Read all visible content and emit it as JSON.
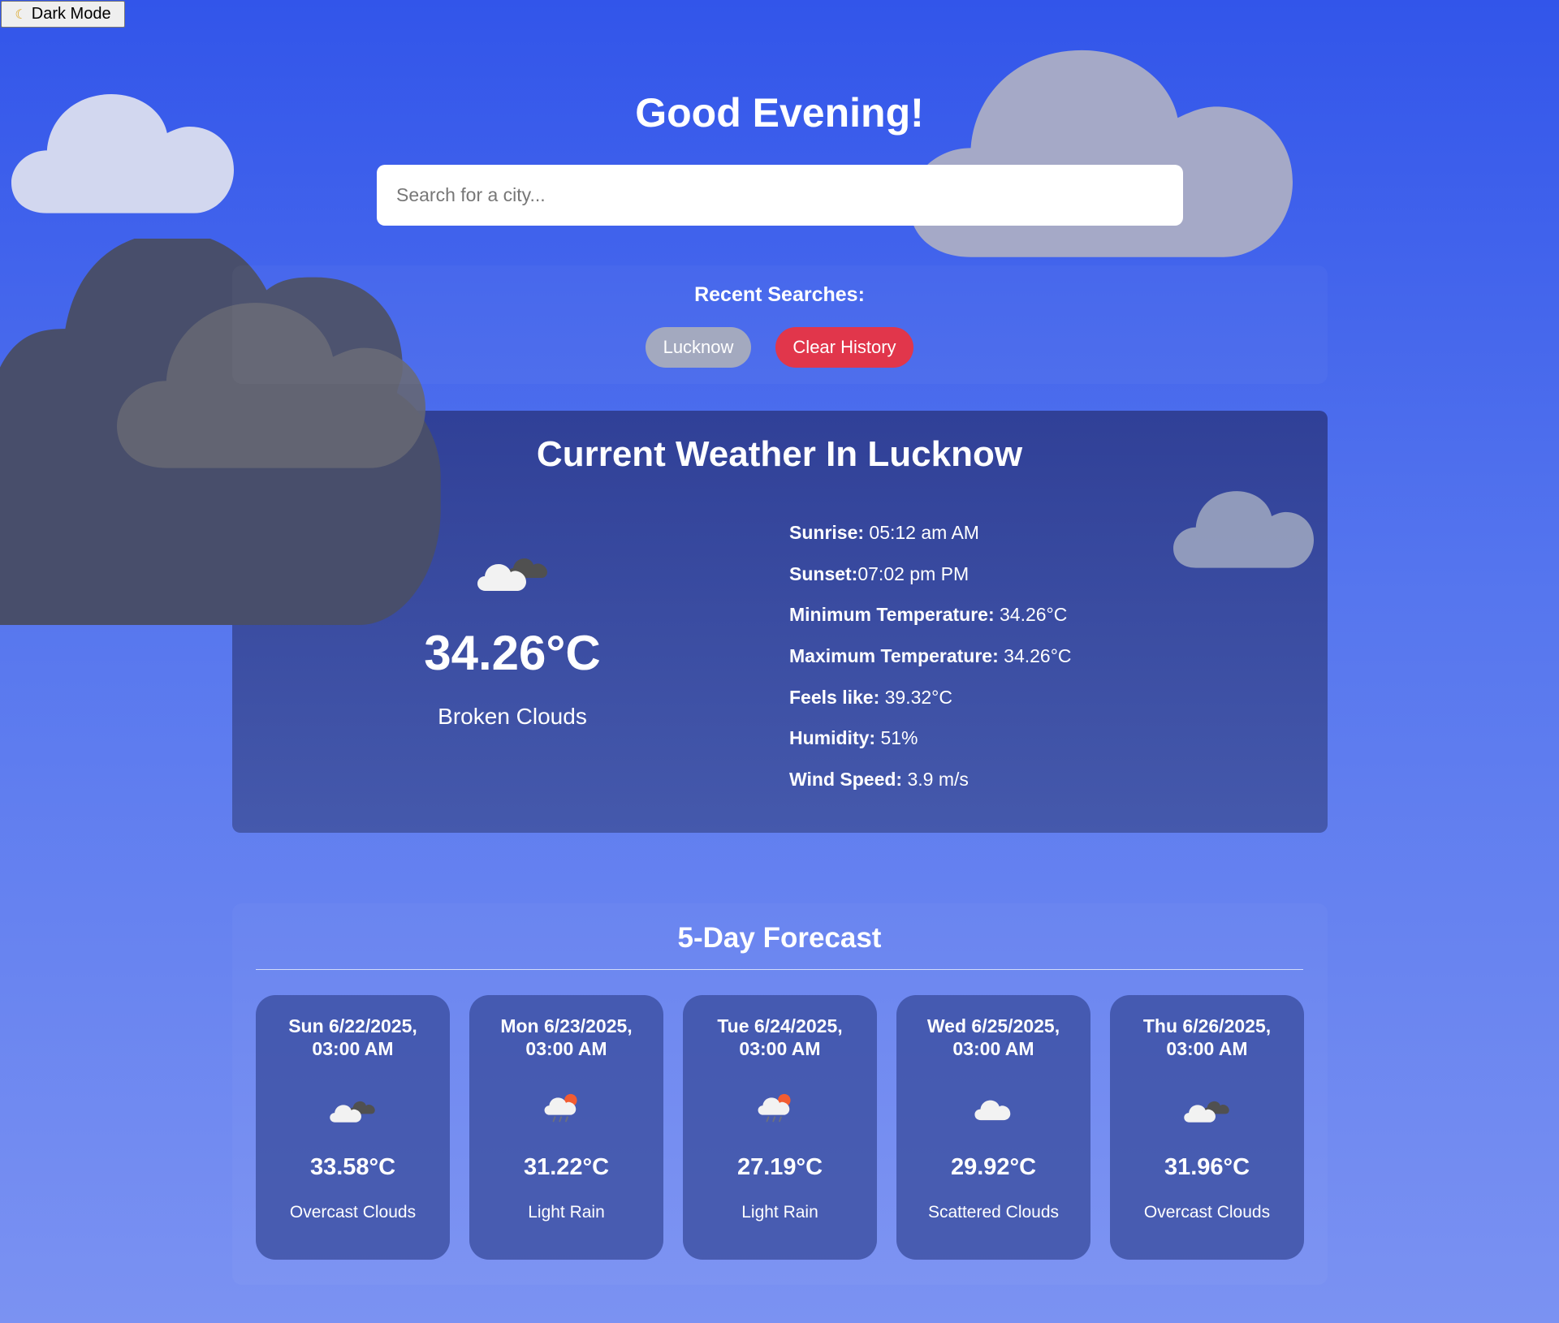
{
  "mode_toggle": {
    "icon": "moon-icon",
    "label": "Dark Mode"
  },
  "greeting": "Good Evening!",
  "search": {
    "placeholder": "Search for a city...",
    "value": ""
  },
  "recent": {
    "title": "Recent Searches:",
    "items": [
      "Lucknow"
    ],
    "clear_label": "Clear History"
  },
  "current": {
    "title": "Current Weather In Lucknow",
    "icon": "broken-clouds-icon",
    "temperature": "34.26°C",
    "description": "Broken Clouds",
    "details": [
      {
        "label": "Sunrise:",
        "value": " 05:12 am AM"
      },
      {
        "label": "Sunset:",
        "value": "07:02 pm PM"
      },
      {
        "label": "Minimum Temperature:",
        "value": " 34.26°C"
      },
      {
        "label": "Maximum Temperature:",
        "value": " 34.26°C"
      },
      {
        "label": "Feels like:",
        "value": " 39.32°C"
      },
      {
        "label": "Humidity:",
        "value": " 51%"
      },
      {
        "label": "Wind Speed:",
        "value": " 3.9 m/s"
      }
    ]
  },
  "forecast": {
    "title": "5-Day Forecast",
    "days": [
      {
        "date": "Sun 6/22/2025,\n03:00 AM",
        "icon": "overcast-clouds-icon",
        "temp": "33.58°C",
        "desc": "Overcast Clouds"
      },
      {
        "date": "Mon 6/23/2025,\n03:00 AM",
        "icon": "light-rain-icon",
        "temp": "31.22°C",
        "desc": "Light Rain"
      },
      {
        "date": "Tue 6/24/2025,\n03:00 AM",
        "icon": "light-rain-icon",
        "temp": "27.19°C",
        "desc": "Light Rain"
      },
      {
        "date": "Wed 6/25/2025,\n03:00 AM",
        "icon": "scattered-clouds-icon",
        "temp": "29.92°C",
        "desc": "Scattered Clouds"
      },
      {
        "date": "Thu 6/26/2025,\n03:00 AM",
        "icon": "overcast-clouds-icon",
        "temp": "31.96°C",
        "desc": "Overcast Clouds"
      }
    ]
  },
  "colors": {
    "background_top": "#3255ea",
    "background_bottom": "#7b92f2",
    "card": "#3a4ca2",
    "clear_button": "#e1364b",
    "recent_chip": "#a3a9bf"
  }
}
